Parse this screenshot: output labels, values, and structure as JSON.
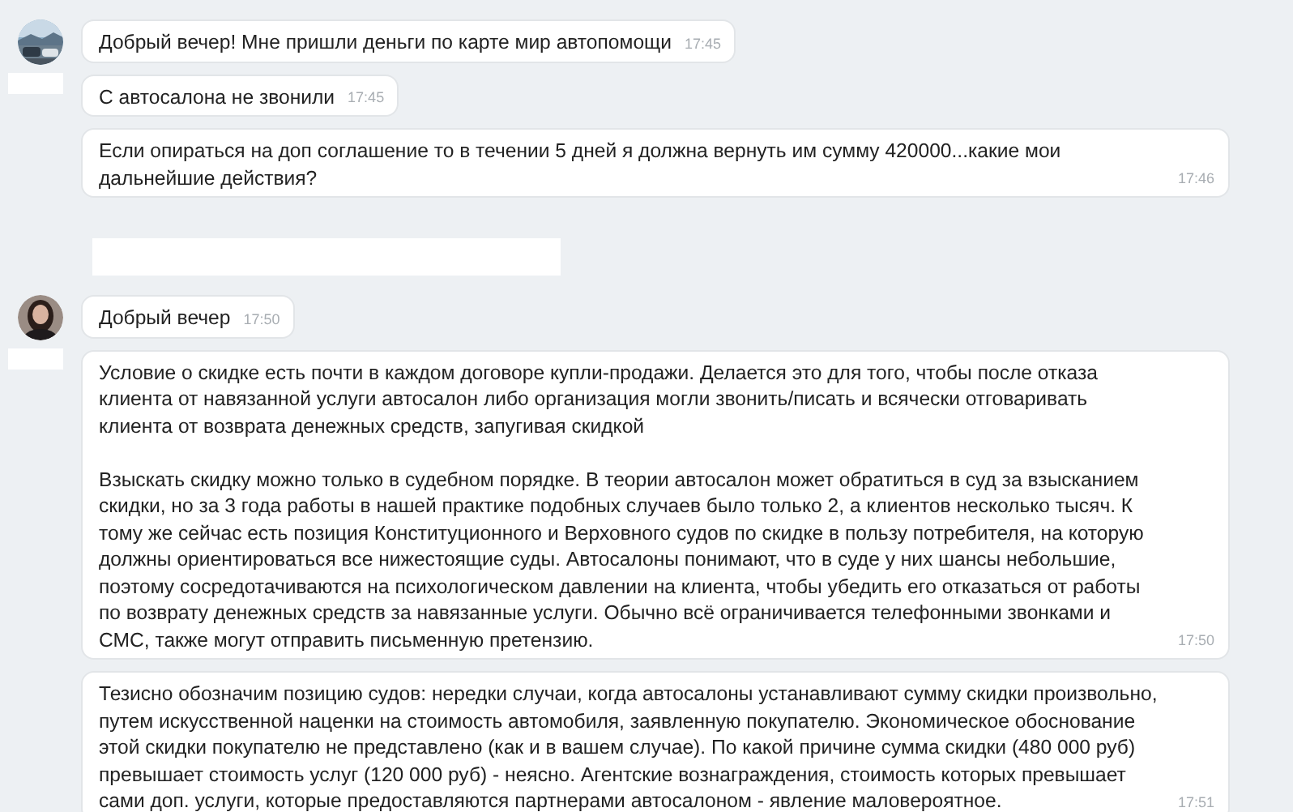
{
  "chat": [
    {
      "kind": "group",
      "name_hidden": true,
      "messages": [
        {
          "paragraphs": [
            "Добрый вечер! Мне пришли деньги по карте мир автопомощи"
          ],
          "time": "17:45"
        },
        {
          "paragraphs": [
            "С автосалона не звонили"
          ],
          "time": "17:45"
        },
        {
          "paragraphs": [
            "Если опираться на доп соглашение то в течении 5 дней я должна вернуть им сумму 420000...какие мои дальнейшие действия?"
          ],
          "time": "17:46"
        }
      ]
    },
    {
      "kind": "redacted"
    },
    {
      "kind": "group",
      "name_hidden": true,
      "messages": [
        {
          "paragraphs": [
            "Добрый вечер"
          ],
          "time": "17:50"
        },
        {
          "paragraphs": [
            "Условие о скидке есть почти в каждом договоре купли-продажи. Делается это для того, чтобы после отказа клиента от навязанной услуги автосалон либо организация могли звонить/писать и всячески отговаривать клиента от возврата денежных средств, запугивая скидкой",
            "Взыскать скидку можно только в судебном порядке. В теории автосалон может обратиться в суд за взысканием скидки, но за 3 года работы в нашей практике подобных случаев было только 2, а клиентов несколько тысяч. К тому же сейчас есть позиция Конституционного и Верховного судов по скидке в пользу потребителя, на которую должны ориентироваться все нижестоящие суды. Автосалоны понимают, что в суде у них шансы небольшие, поэтому сосредотачиваются на психологическом давлении на клиента, чтобы убедить его отказаться от работы по возврату денежных средств за навязанные услуги. Обычно всё ограничивается телефонными звонками и СМС, также могут отправить письменную претензию."
          ],
          "time": "17:50"
        },
        {
          "paragraphs": [
            "Тезисно обозначим позицию судов: нередки случаи, когда автосалоны устанавливают сумму скидки произвольно, путем искусственной наценки на стоимость автомобиля, заявленную покупателю. Экономическое обоснование этой скидки покупателю не представлено (как и в вашем случае). По какой причине сумма скидки (480 000 руб) превышает стоимость услуг (120 000 руб) - неясно. Агентские вознаграждения, стоимость которых превышает сами доп. услуги, которые предоставляются партнерами автосалоном - явление маловероятное."
          ],
          "time": "17:51"
        }
      ]
    }
  ]
}
